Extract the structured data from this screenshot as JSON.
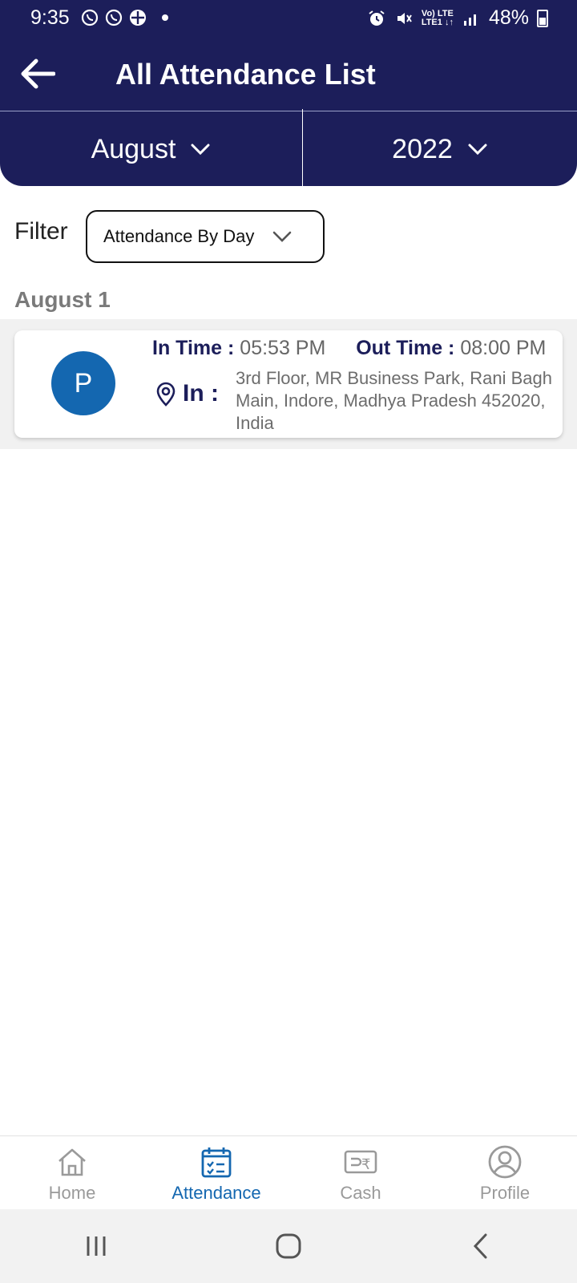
{
  "status_bar": {
    "time": "9:35",
    "battery": "48%",
    "network_top": "Vo) LTE",
    "network_bottom": "LTE1 ↓↑"
  },
  "header": {
    "title": "All Attendance List",
    "month": "August",
    "year": "2022"
  },
  "filter": {
    "label": "Filter",
    "selected": "Attendance By Day"
  },
  "section": {
    "date": "August 1"
  },
  "records": [
    {
      "avatar_letter": "P",
      "in_time_label": "In Time :",
      "in_time": "05:53 PM",
      "out_time_label": "Out Time :",
      "out_time": "08:00 PM",
      "location_label": "In :",
      "address": "3rd Floor, MR Business Park, Rani Bagh Main, Indore, Madhya Pradesh 452020, India"
    }
  ],
  "bottom_nav": [
    {
      "label": "Home",
      "icon": "home-icon",
      "active": false
    },
    {
      "label": "Attendance",
      "icon": "calendar-icon",
      "active": true
    },
    {
      "label": "Cash",
      "icon": "cash-icon",
      "active": false
    },
    {
      "label": "Profile",
      "icon": "profile-icon",
      "active": false
    }
  ],
  "colors": {
    "primary": "#1c1e5a",
    "accent": "#1467b0",
    "inactive": "#9a9a9a"
  }
}
